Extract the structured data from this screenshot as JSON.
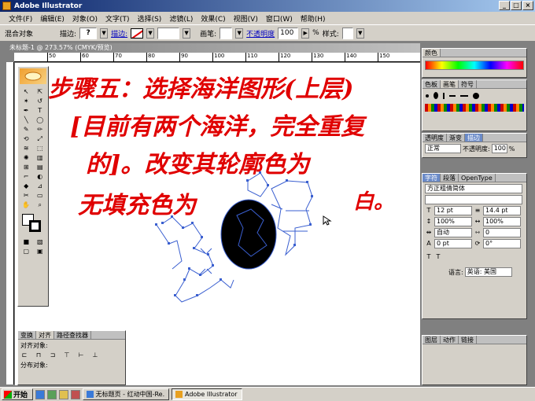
{
  "window": {
    "title": "Adobe Illustrator",
    "controls": [
      "_",
      "□",
      "×"
    ]
  },
  "menu": [
    "文件(F)",
    "编辑(E)",
    "对象(O)",
    "文字(T)",
    "选择(S)",
    "滤镜(L)",
    "效果(C)",
    "视图(V)",
    "窗口(W)",
    "帮助(H)"
  ],
  "control_bar": {
    "object_label": "混合对象",
    "fill_label": "描边:",
    "fill_value": "?",
    "stroke_link": "描边:",
    "opacity_label": "不透明度",
    "opacity_value": "100",
    "opacity_unit": "%",
    "style_label": "样式:",
    "brush_label": "画笔:"
  },
  "document": {
    "title": "未标题-1 @ 273.57% (CMYK/预览)",
    "ruler_ticks": [
      "50",
      "60",
      "70",
      "80",
      "90",
      "100",
      "110",
      "120",
      "130",
      "140",
      "150"
    ]
  },
  "annotation": {
    "line1": "步骤五：选择海洋图形(上层)",
    "line2": "[目前有两个海洋，完全重复",
    "line3": "的]。改变其轮廓色为",
    "line4a": "无填充色为",
    "line4b": "白。"
  },
  "panels": {
    "color": {
      "tabs": [
        "颜色"
      ]
    },
    "brushes": {
      "tabs": [
        "色板",
        "画笔",
        "符号"
      ]
    },
    "transparency": {
      "tabs": [
        "透明度",
        "渐变",
        "描边"
      ],
      "mode": "正常",
      "opacity_label": "不透明度:",
      "opacity_value": "100",
      "opacity_unit": "%"
    },
    "character": {
      "tabs": [
        "字符",
        "段落",
        "OpenType"
      ],
      "font": "方正粗倩简体",
      "size": "12 pt",
      "leading": "14.4 pt",
      "scale_h": "100%",
      "scale_v": "100%",
      "kerning": "自动",
      "tracking": "0",
      "baseline": "0 pt",
      "rotation": "0°",
      "language_label": "语言:",
      "language_value": "英语: 美国"
    },
    "bottom_right": {
      "tabs": [
        "图层",
        "动作",
        "链接"
      ]
    }
  },
  "align": {
    "tabs": [
      "变换",
      "对齐",
      "路径查找器"
    ],
    "align_objects": "对齐对象:",
    "distribute_objects": "分布对象:"
  },
  "taskbar": {
    "start": "开始",
    "tasks": [
      "无标题页 - 红动中国-Re...",
      "Adobe Illustrator"
    ]
  }
}
